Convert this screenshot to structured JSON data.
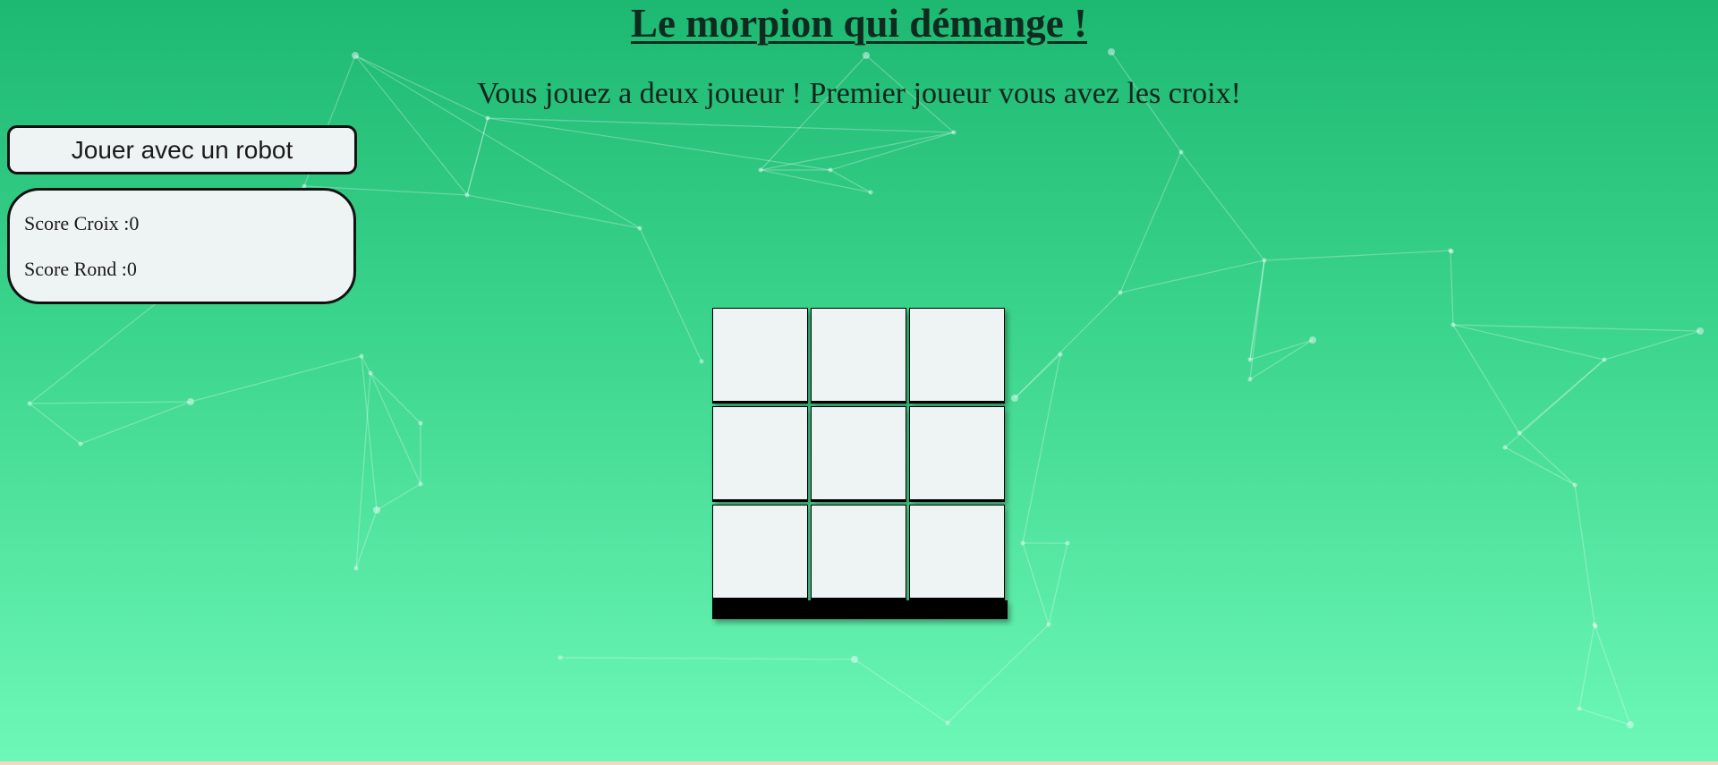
{
  "title": "Le morpion qui démange !",
  "subtitle": "Vous jouez a deux joueur ! Premier joueur vous avez les croix!",
  "robot_button": {
    "label": "Jouer avec un robot"
  },
  "scores": {
    "cross": "Score Croix :0",
    "circle": "Score Rond :0"
  },
  "board": {
    "cells": [
      "",
      "",
      "",
      "",
      "",
      "",
      "",
      "",
      ""
    ]
  },
  "colors": {
    "background_top": "#1db872",
    "background_bottom": "#6ef8b8",
    "panel": "#eef4f3",
    "border": "#111111"
  }
}
